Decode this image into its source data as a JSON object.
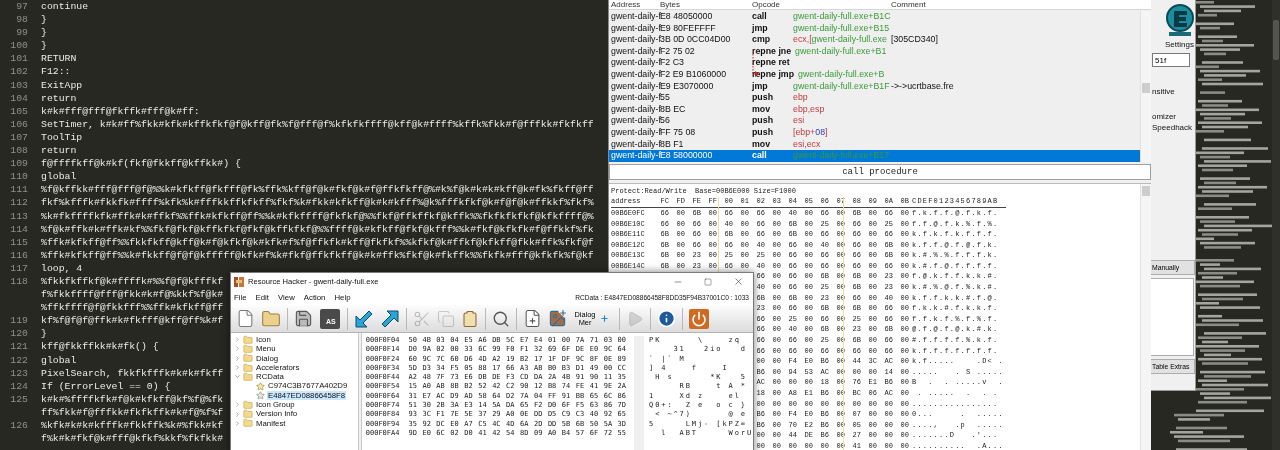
{
  "editor": {
    "lines": [
      {
        "number": "97",
        "rows": [
          "continue"
        ]
      },
      {
        "number": "98",
        "rows": [
          "}"
        ]
      },
      {
        "number": "99",
        "rows": [
          "}"
        ]
      },
      {
        "number": "100",
        "rows": [
          "}"
        ]
      },
      {
        "number": "101",
        "rows": [
          "RETURN"
        ]
      },
      {
        "number": "102",
        "rows": [
          "F12::"
        ]
      },
      {
        "number": "103",
        "rows": [
          "ExitApp"
        ]
      },
      {
        "number": "104",
        "rows": [
          "return"
        ]
      },
      {
        "number": "105",
        "rows": [
          "k#k#fff@fff@fkffk#fff@k#ff:"
        ]
      },
      {
        "number": "106",
        "rows": [
          "SetTimer, k#k#ff%fkk#kfk#kffkfkf@f@kff@fk%f@fff@f%kfkfkffff@kff@k#ffff%kffk%fkk#f@fffkk#fkfkff"
        ]
      },
      {
        "number": "107",
        "rows": [
          "ToolTip"
        ]
      },
      {
        "number": "108",
        "rows": [
          "return"
        ]
      },
      {
        "number": "109",
        "rows": [
          "f@ffffkff@k#kf(fkf@fkkff@kffkk#) {"
        ]
      },
      {
        "number": "110",
        "rows": [
          "global"
        ]
      },
      {
        "number": "111",
        "rows": [
          "%f@kffkk#fff@fff@f@%%k#kfkff@fkfff@fk%ffk%kff@f@k#fkf@k#f@ffkfkff@%#k%f@k#k#k#kff@k#fk%fkff@ff"
        ]
      },
      {
        "number": "112",
        "rows": [
          "fkf%kfffk#fkkfk#ffff%kfk%k#fffkkffkfkff%fkf%k#fkk#kfkff@k#k#kfff%@k%fffkfkf@k#f@f@k#ffkkf%fkf%"
        ]
      },
      {
        "number": "113",
        "rows": [
          "%k#fkffffkfk#ffk#k#ffkf%%ffk#kfkff@ff%%k#kfkffff@fkfkf@%%fkf@ffkffkf@kffk%%fkfkfkfkf@kfkffff@%"
        ]
      },
      {
        "number": "114",
        "rows": [
          "%f@k#ffk#k#ffk#kf%%fkf@fkf@kffkfkf@fkf@kffkfkf@%%ffff@k#kfkff@fkf@kfff%%k#fkf@kfkfk#f@ffkkf%fk"
        ]
      },
      {
        "number": "115",
        "rows": [
          "%ffk#kfkff@ff%%fkkfkff@kff@k#f@kfkf@k#kfk#f%f@ffkfk#kff@fkfkf%%kfkf@k#ffkf@kfkff@fkk#ffk%fkf@f"
        ]
      },
      {
        "number": "116",
        "rows": [
          "%ffk#kfkff@ff%%k#fkkff@f@f@kfffff@kfk#f%k#fkf@ffkfkff@k#k#ffk%fkf@k#fkffk%%fkfk#fff@kfkfk%f@kf"
        ]
      },
      {
        "number": "117",
        "rows": [
          "loop, 4"
        ]
      },
      {
        "number": "118",
        "rows": [
          "%fkkfkffkf@k#ffffk#%%f@f@kfffkf",
          "f%fkkffff@fff@fkk#k#f@%kkf%f@k#",
          "%ffkffff@f@fkkfff%%ffk#kfkff@ff"
        ]
      },
      {
        "number": "119",
        "rows": [
          "kf%f@f@f@ffk#k#fkfff@kff@ff%k#f"
        ]
      },
      {
        "number": "120",
        "rows": [
          "}"
        ]
      },
      {
        "number": "121",
        "rows": [
          "kff@fkkffkk#k#fk() {"
        ]
      },
      {
        "number": "122",
        "rows": [
          "global"
        ]
      },
      {
        "number": "123",
        "rows": [
          "PixelSearch, fkkfkfffk#k#k#fkff"
        ]
      },
      {
        "number": "124",
        "rows": [
          "If (ErrorLevel == 0) {"
        ]
      },
      {
        "number": "125",
        "rows": [
          "k#k#%ffffkfk#f@k#kfkff@kf%f@%fk",
          "ff%fkk#f@fffkk#fkfkffk#k#f@%f%f"
        ]
      },
      {
        "number": "126",
        "rows": [
          "%kfk#k#k#kfffk#fkkffk%k#%fkk#kf",
          "f%k#k#fkf@k#fff@kfkf%kkf%fkfkk#"
        ]
      }
    ]
  },
  "memory_viewer": {
    "columns": [
      "Address",
      "Bytes",
      "Opcode",
      "Comment"
    ],
    "rows": [
      {
        "address": "gwent-daily-f",
        "bytes": "E8 48050000",
        "opcode": "call",
        "operand": [
          {
            "kind": "address",
            "text": "gwent-daily-full.exe+B1C"
          }
        ],
        "selected": false
      },
      {
        "address": "gwent-daily-f",
        "bytes": "E9 80FEFFFF",
        "opcode": "jmp",
        "operand": [
          {
            "kind": "address",
            "text": "gwent-daily-full.exe+B15"
          }
        ],
        "selected": false
      },
      {
        "address": "gwent-daily-f",
        "bytes": "3B 0D 0CC04D00",
        "opcode": "cmp",
        "operand": [
          {
            "kind": "register",
            "text": "ecx,["
          },
          {
            "kind": "address",
            "text": "gwent-daily-full.exe"
          }
        ],
        "comment": "[305CD340]",
        "selected": false
      },
      {
        "address": "gwent-daily-f",
        "bytes": "F2 75 02",
        "opcode": "repne jne",
        "operand": [
          {
            "kind": "address",
            "text": "gwent-daily-full.exe+B1"
          }
        ],
        "selected": false
      },
      {
        "address": "gwent-daily-f",
        "bytes": "F2 C3",
        "opcode": "repne ret",
        "selected": false
      },
      {
        "address": "gwent-daily-f",
        "bytes": "F2 E9 B1060000",
        "opcode": "repne jmp",
        "operand": [
          {
            "kind": "address",
            "text": "gwent-daily-full.exe+B"
          }
        ],
        "selected": false
      },
      {
        "address": "gwent-daily-f",
        "bytes": "E9 E3070000",
        "opcode": "jmp",
        "operand": [
          {
            "kind": "address",
            "text": "gwent-daily-full.exe+B1F"
          }
        ],
        "comment": "->->ucrtbase.fre",
        "selected": false
      },
      {
        "address": "gwent-daily-f",
        "bytes": "55",
        "opcode": "push",
        "operand": [
          {
            "kind": "register",
            "text": "ebp"
          }
        ],
        "selected": false
      },
      {
        "address": "gwent-daily-f",
        "bytes": "8B EC",
        "opcode": "mov",
        "operand": [
          {
            "kind": "register",
            "text": "ebp,esp"
          }
        ],
        "selected": false
      },
      {
        "address": "gwent-daily-f",
        "bytes": "56",
        "opcode": "push",
        "operand": [
          {
            "kind": "register",
            "text": "esi"
          }
        ],
        "selected": false
      },
      {
        "address": "gwent-daily-f",
        "bytes": "FF 75 08",
        "opcode": "push",
        "operand": [
          {
            "kind": "register",
            "text": "[ebp+"
          },
          {
            "kind": "number",
            "text": "08"
          },
          {
            "kind": "register",
            "text": "]"
          }
        ],
        "selected": false
      },
      {
        "address": "gwent-daily-f",
        "bytes": "8B F1",
        "opcode": "mov",
        "operand": [
          {
            "kind": "register",
            "text": "esi,ecx"
          }
        ],
        "selected": false
      },
      {
        "address": "gwent-daily-f",
        "bytes": "E8 58000000",
        "opcode": "call",
        "operand": [
          {
            "kind": "address",
            "text": "gwent-daily-full.exe+B17"
          }
        ],
        "selected": true
      }
    ],
    "status": "call procedure",
    "hex": {
      "info": "Protect:Read/Write  Base=00B6E000 Size=F1000",
      "header": {
        "label": "address",
        "bytes": "FC FD FE FF 00 01 02 03 04 05 06 07 08 09 0A 0B",
        "ascii": "CDEF0123456789AB"
      },
      "rows": [
        {
          "address": "00B6E0FC",
          "bytes": "66 00 6B 00 66 00 66 00 40 00 66 00 6B 00 66 00",
          "ascii": "f.k.f.f.@.f.k.f."
        },
        {
          "address": "00B6E10C",
          "bytes": "66 00 66 00 40 00 66 00 6B 00 25 00 66 00 25 00",
          "ascii": "f.f.@.f.k.%.f.%."
        },
        {
          "address": "00B6E11C",
          "bytes": "6B 00 66 00 6B 00 66 00 6B 00 66 00 66 00 66 00",
          "ascii": "k.f.k.f.k.f.f.f."
        },
        {
          "address": "00B6E12C",
          "bytes": "6B 00 66 00 66 00 40 00 66 00 40 00 66 00 6B 00",
          "ascii": "k.f.f.@.f.@.f.k."
        },
        {
          "address": "00B6E13C",
          "bytes": "6B 00 23 00 25 00 25 00 66 00 66 00 66 00 6B 00",
          "ascii": "k.#.%.%.f.f.f.k."
        },
        {
          "address": "00B6E14C",
          "bytes": "6B 00 23 00 66 00 40 00 66 00 66 00 66 00 66 00",
          "ascii": "k.#.f.@.f.f.f.f."
        },
        {
          "bytes": "66 00 66 00 6B 00 6B 00 23 00",
          "ascii": "f.@.k.f.f.k.k.#."
        },
        {
          "bytes": "40 00 66 00 25 00 6B 00 23 00",
          "ascii": "k.#.%.@.f.%.k.#."
        },
        {
          "bytes": "6B 00 6B 00 23 00 66 00 40 00",
          "ascii": "k.f.f.k.k.#.f.@."
        },
        {
          "bytes": "23 00 66 00 6B 00 6B 00 66 00",
          "ascii": "f.k.k.#.f.k.k.f."
        },
        {
          "bytes": "66 00 25 00 66 00 25 00 66 00",
          "ascii": "f.f.k.f.%.f.%.f."
        },
        {
          "bytes": "66 00 40 00 6B 00 23 00 6B 00",
          "ascii": "@.f.@.f.@.k.#.k."
        },
        {
          "bytes": "66 00 66 00 25 00 6B 00 66 00",
          "ascii": "#.f.f.f.f.%.k.f."
        },
        {
          "bytes": "66 00 66 00 66 00 66 00 66 00",
          "ascii": "k.f.f.f.f.f.f.f."
        },
        {
          "bytes": "00 00 F4 E0 B6 00 44 3C AC 00",
          "ascii": "k.f.....    .D< ."
        },
        {
          "bytes": "B6 00 94 53 AC 00 00 00 14 00",
          "ascii": ".....   . S ....."
        },
        {
          "bytes": "AC 00 00 00 18 00 76 E1 B6 00",
          "ascii": "B  .  . .....v  ."
        },
        {
          "bytes": "18 00 A8 E1 B6 00 BC 06 AC 00",
          "ascii": " . .....  .  . ."
        },
        {
          "bytes": "00 00 00 00 00 00 00 00 00 00",
          "ascii": "................"
        },
        {
          "bytes": "B6 00 F4 E0 B6 00 07 00 00 00",
          "ascii": "0...     .  ....."
        },
        {
          "bytes": "B6 00 70 E2 B6 00 05 00 00 00",
          "ascii": "....,   .p  ....."
        },
        {
          "bytes": "00 00 44 DE B6 00 27 00 00 00",
          "ascii": ".......D   .'..."
        },
        {
          "bytes": "00 00 00 00 00 00 41 00 00 00",
          "ascii": "..........  .A..."
        }
      ]
    }
  },
  "resource_hacker": {
    "title": "Resource Hacker - gwent-daily-full.exe",
    "menu": [
      "File",
      "Edit",
      "View",
      "Action",
      "Help"
    ],
    "path": "RCData : E4847ED08866458F8DD35F94B37001C0 : 1033",
    "toolbar": [
      {
        "disabled": false
      },
      {
        "disabled": false
      },
      {
        "disabled": false
      },
      {
        "label": "AS",
        "disabled": false
      },
      {
        "disabled": false
      },
      {
        "disabled": false
      },
      {
        "disabled": true
      },
      {
        "disabled": true
      },
      {
        "disabled": false
      },
      {
        "disabled": false
      },
      {
        "disabled": false
      },
      {
        "disabled": false
      },
      {
        "label": "Dialog Mer",
        "disabled": false
      },
      {
        "disabled": true
      },
      {
        "disabled": false
      },
      {
        "disabled": false
      }
    ],
    "tree": [
      {
        "label": "Icon",
        "expanded": false,
        "selected": false
      },
      {
        "label": "Menu",
        "expanded": false,
        "selected": false
      },
      {
        "label": "Dialog",
        "expanded": false,
        "selected": false
      },
      {
        "label": "Accelerators",
        "expanded": false,
        "selected": false
      },
      {
        "label": "RCData",
        "expanded": true,
        "selected": false,
        "children": [
          {
            "label": "C974C3B7677A402D9",
            "selected": false
          },
          {
            "label": "E4847ED08866458F8",
            "selected": true
          }
        ]
      },
      {
        "label": "Icon Group",
        "expanded": false,
        "selected": false
      },
      {
        "label": "Version Info",
        "expanded": false,
        "selected": false
      },
      {
        "label": "Manifest",
        "expanded": false,
        "selected": false
      }
    ],
    "hex": {
      "rows": [
        {
          "address": "000F0F04",
          "bytes": "50 4B 03 04 E5 A6 DB 5C E7 E4 01 00 7A 71 03 00",
          "ascii": "PK      \\    zq"
        },
        {
          "address": "000F0F14",
          "bytes": "D0 9A 02 00 33 6C 99 F0 F1 32 69 6F DE E0 9C 64",
          "ascii": "    31   2io   d"
        },
        {
          "address": "000F0F24",
          "bytes": "60 9C 7C 60 D6 4D A2 19 B2 17 1F DF 9C 8F 0E 89",
          "ascii": "` |` M"
        },
        {
          "address": "000F0F34",
          "bytes": "5D D3 34 F5 05 88 17 66 A3 AB B0 B3 D1 49 00 CC",
          "ascii": "] 4    f    I"
        },
        {
          "address": "000F0F44",
          "bytes": "A2 48 7F 73 E6 DB DE F3 CD DA 2A 4B 91 90 11 35",
          "ascii": " H s      *K   5"
        },
        {
          "address": "000F0F54",
          "bytes": "15 A0 AB 8B B2 52 42 C2 90 12 B8 74 FE 41 9E 2A",
          "ascii": "     RB    t A *"
        },
        {
          "address": "000F0F64",
          "bytes": "31 E7 AC D9 AD 58 64 D2 7A 04 FF 91 BB 65 6C 86",
          "ascii": "1    Xd z    el"
        },
        {
          "address": "000F0F74",
          "bytes": "51 30 2B 3A E3 14 5A DA 65 F2 D0 6F F5 63 86 7D",
          "ascii": "Q0+:  Z e  o c }"
        },
        {
          "address": "000F0F84",
          "bytes": "93 3C F1 7E 5E 37 29 A0 0E DD D5 C9 C3 40 92 65",
          "ascii": " < ~^7)      @ e"
        },
        {
          "address": "000F0F94",
          "bytes": "35 92 DC E0 A7 C5 4C 4D 6A 2D DD 5B 6B 50 5A 3D",
          "ascii": "5     LMj- [kPZ="
        },
        {
          "address": "000F0FA4",
          "bytes": "9D E0 6C 02 D0 41 42 54 8D 09 A0 B4 57 6F 72 55",
          "ascii": "  l  ABT     WorU"
        }
      ]
    }
  },
  "cheat_engine": {
    "settings": "Settings",
    "value": "51f",
    "options": [
      "nsitive",
      "omizer",
      "Speedhack"
    ],
    "buttons": [
      "Manually",
      "Table Extras"
    ]
  }
}
